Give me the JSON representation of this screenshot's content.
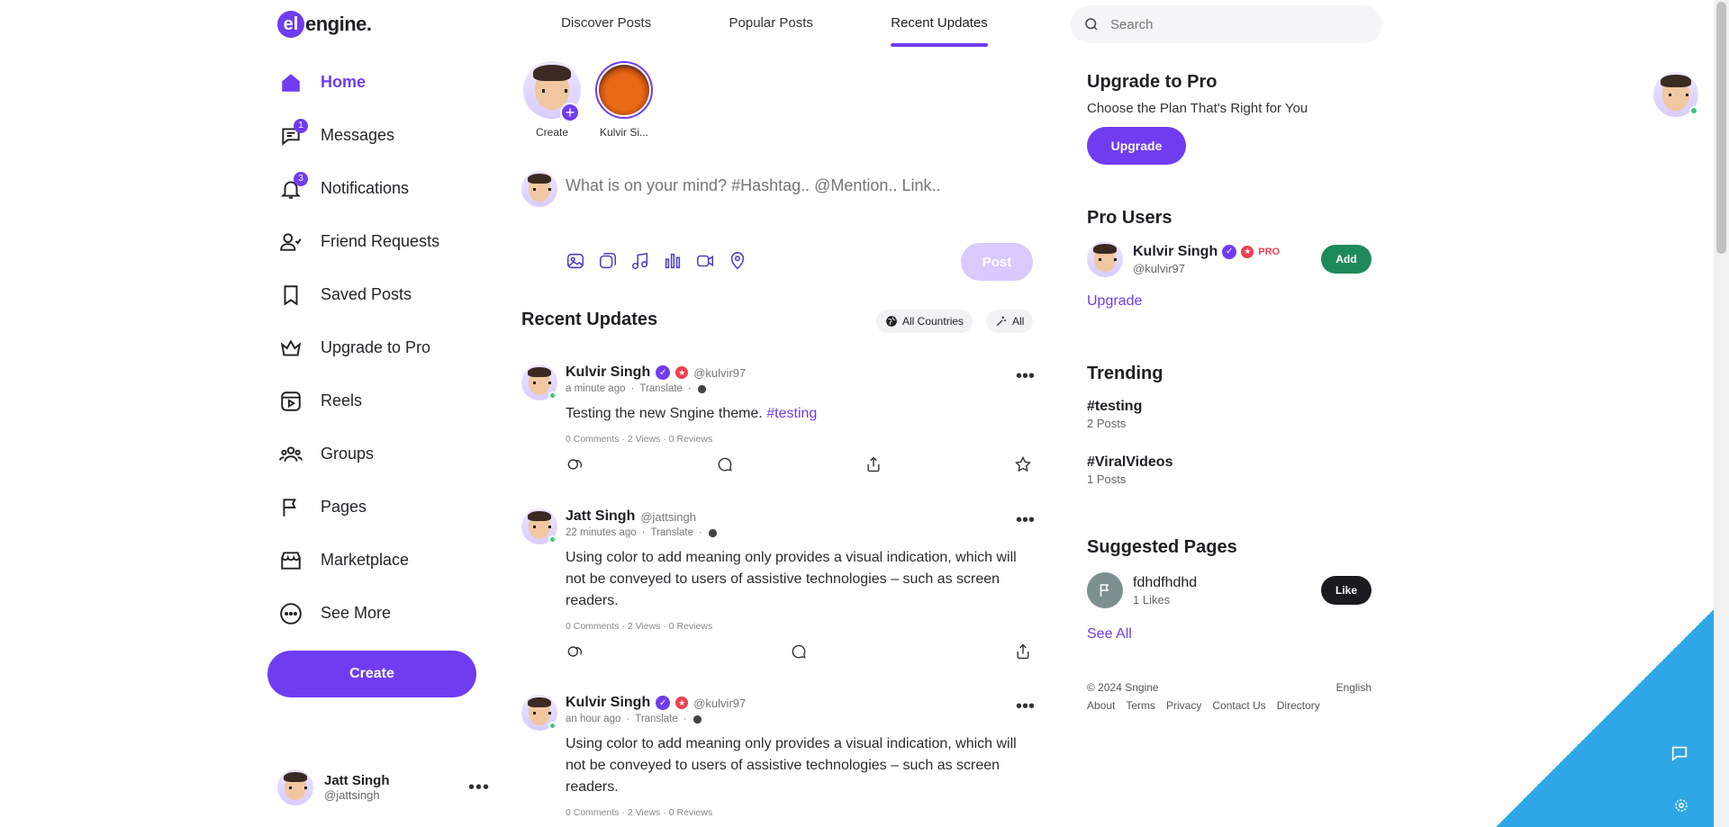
{
  "brand": {
    "logo_letter": "el",
    "logo_text": "engine."
  },
  "tabs": [
    {
      "label": "Discover Posts"
    },
    {
      "label": "Popular Posts"
    },
    {
      "label": "Recent Updates",
      "active": true
    }
  ],
  "sidebar": {
    "items": [
      {
        "label": "Home",
        "icon": "home-icon",
        "active": true
      },
      {
        "label": "Messages",
        "icon": "chat-icon",
        "badge": "1"
      },
      {
        "label": "Notifications",
        "icon": "bell-icon",
        "badge": "3"
      },
      {
        "label": "Friend Requests",
        "icon": "users-icon"
      },
      {
        "label": "Saved Posts",
        "icon": "bookmark-icon"
      },
      {
        "label": "Upgrade to Pro",
        "icon": "crown-icon"
      },
      {
        "label": "Reels",
        "icon": "reels-icon"
      },
      {
        "label": "Groups",
        "icon": "groups-icon"
      },
      {
        "label": "Pages",
        "icon": "flag-icon"
      },
      {
        "label": "Marketplace",
        "icon": "store-icon"
      },
      {
        "label": "See More",
        "icon": "more-circle-icon"
      }
    ],
    "create_label": "Create",
    "me": {
      "name": "Jatt Singh",
      "handle": "@jattsingh"
    }
  },
  "stories": [
    {
      "caption": "Create"
    },
    {
      "caption": "Kulvir Si..."
    }
  ],
  "composer": {
    "placeholder": "What is on your mind? #Hashtag.. @Mention.. Link..",
    "post_label": "Post"
  },
  "feed": {
    "title": "Recent Updates",
    "filter_countries": "All Countries",
    "filter_all": "All",
    "posts": [
      {
        "name": "Kulvir Singh",
        "handle": "@kulvir97",
        "time": "a minute ago",
        "translate": "Translate",
        "text": "Testing the new Sngine theme. ",
        "tag": "#testing",
        "stats": "0 Comments · 2 Views · 0 Reviews"
      },
      {
        "name": "Jatt Singh",
        "handle": "@jattsingh",
        "time": "22 minutes ago",
        "translate": "Translate",
        "text": "Using color to add meaning only provides a visual indication, which will not be conveyed to users of assistive technologies – such as screen readers.",
        "stats": "0 Comments · 2 Views · 0 Reviews"
      },
      {
        "name": "Kulvir Singh",
        "handle": "@kulvir97",
        "time": "an hour ago",
        "translate": "Translate",
        "text": "Using color to add meaning only provides a visual indication, which will not be conveyed to users of assistive technologies – such as screen readers.",
        "stats": "0 Comments · 2 Views · 0 Reviews"
      }
    ]
  },
  "search": {
    "placeholder": "Search"
  },
  "right": {
    "upgrade_title": "Upgrade to Pro",
    "upgrade_sub": "Choose the Plan That's Right for You",
    "upgrade_button": "Upgrade",
    "pro_users_title": "Pro Users",
    "pro_user": {
      "name": "Kulvir Singh",
      "handle": "@kulvir97",
      "pro_label": "PRO",
      "add_label": "Add"
    },
    "pro_users_link": "Upgrade",
    "trending_title": "Trending",
    "trending": [
      {
        "tag": "#testing",
        "count": "2 Posts"
      },
      {
        "tag": "#ViralVideos",
        "count": "1 Posts"
      }
    ],
    "suggested_title": "Suggested Pages",
    "suggested_page": {
      "name": "fdhdfhdhd",
      "likes": "1 Likes",
      "like_label": "Like"
    },
    "see_all": "See All",
    "footer": {
      "copyright": "© 2024 Sngine",
      "language": "English",
      "links": [
        "About",
        "Terms",
        "Privacy",
        "Contact Us",
        "Directory"
      ]
    }
  },
  "colors": {
    "accent": "#6f3cf0",
    "success": "#1e8a5a",
    "danger": "#ef4050"
  }
}
